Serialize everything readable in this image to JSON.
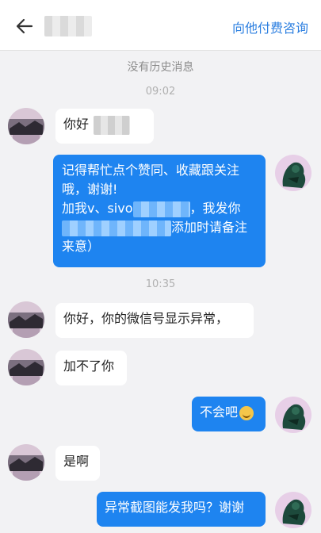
{
  "header": {
    "back_icon": "arrow-left-icon",
    "contact_name": "",
    "consult_label": "向他付费咨询"
  },
  "system": {
    "no_history": "没有历史消息"
  },
  "timestamps": [
    "09:02",
    "10:35"
  ],
  "messages": [
    {
      "side": "in",
      "text": "你好"
    },
    {
      "side": "out",
      "lines": [
        "记得帮忙点个赞同、收藏跟关注",
        "哦，谢谢!",
        "加我v、sivo",
        "，我发你",
        "添加时请备注",
        "来意）"
      ]
    },
    {
      "side": "in",
      "text": "你好，你的微信号显示异常，"
    },
    {
      "side": "in",
      "text": "加不了你"
    },
    {
      "side": "out",
      "text": "不会吧",
      "emoji": "laughing-emoji-icon"
    },
    {
      "side": "in",
      "text": "是啊"
    },
    {
      "side": "out",
      "text": "异常截图能发我吗？谢谢"
    }
  ],
  "colors": {
    "accent": "#2c7fe0",
    "outgoing_bubble": "#1e84f0",
    "incoming_bubble": "#ffffff",
    "background": "#f2f2f4"
  }
}
